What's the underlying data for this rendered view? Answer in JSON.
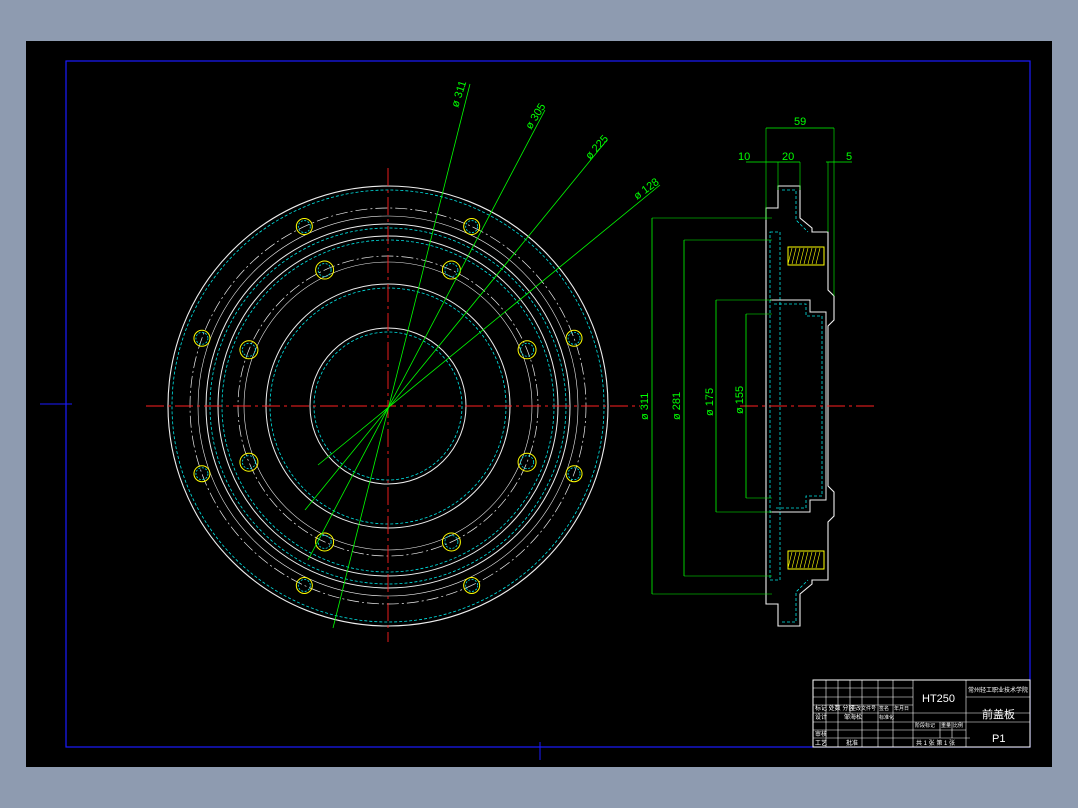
{
  "colors": {
    "app_bg": "#8e9bb0",
    "paper": "#000000",
    "frame": "#1a1aff",
    "outline": "#eeeeee",
    "dash": "#00e5e5",
    "center": "#ff2020",
    "dim": "#00ff00",
    "hatch": "#ffff00",
    "title_text": "#ffffff"
  },
  "front_view": {
    "dim_labels": [
      "ø 311",
      "ø 305",
      "ø 225",
      "ø 128"
    ]
  },
  "section_view": {
    "top_dims": {
      "total": "59",
      "left": "10",
      "mid": "20",
      "right": "5"
    },
    "vertical_dims": [
      "ø 311",
      "ø 281",
      "ø 175",
      "ø 155"
    ]
  },
  "title_block": {
    "material": "HT250",
    "school": "常州轻工职业技术学院",
    "part_name": "前盖板",
    "drawing_no": "P1",
    "left_labels": [
      "标记 处数 分区",
      "设计",
      "审核",
      "工艺"
    ],
    "designer": "邹海松",
    "approver": "批准",
    "mid_texts": [
      "更改文件号",
      "签名",
      "年月日",
      "标准化",
      "阶段标记",
      "重量",
      "比例"
    ],
    "sheet_text": "共 1 张 第 1 张"
  }
}
